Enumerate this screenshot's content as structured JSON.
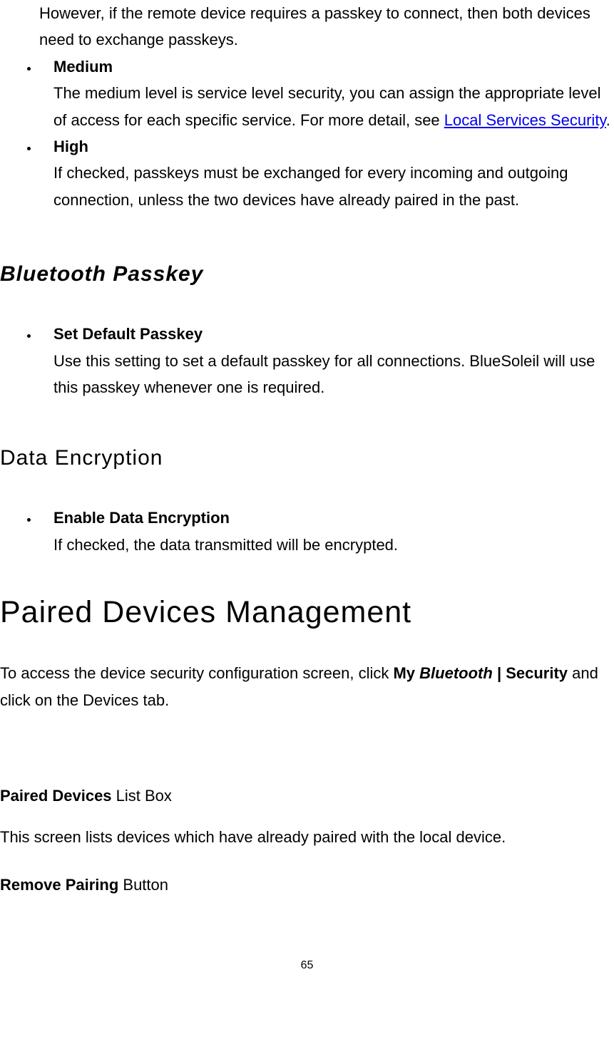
{
  "list1": {
    "item1": {
      "lead_text": "However, if the remote device requires a passkey to connect, then both devices need to exchange passkeys."
    },
    "item2": {
      "title": "Medium",
      "desc_before": "The medium level is service level security, you can assign the appropriate level of access for each specific service. For more detail, see ",
      "link_text": "Local Services Security",
      "desc_after": "."
    },
    "item3": {
      "title": "High",
      "desc": "If checked, passkeys must be exchanged for every incoming and outgoing connection, unless the two devices have already paired in the past."
    }
  },
  "heading1": "Bluetooth Passkey",
  "list2": {
    "item1": {
      "title": "Set Default Passkey",
      "desc": "Use this setting to set a default passkey for all connections. BlueSoleil will use this passkey whenever one is required."
    }
  },
  "heading2": "Data Encryption",
  "list3": {
    "item1": {
      "title": "Enable Data Encryption",
      "desc": "If checked, the data transmitted will be encrypted."
    }
  },
  "heading3": "Paired Devices Management",
  "para1": {
    "before": "To access the device security configuration screen, click ",
    "bold1": "My ",
    "bolditalic": "Bluetooth",
    "bold2": " | Security",
    "after": " and click on the Devices tab."
  },
  "p2_bold": "Paired Devices",
  "p2_rest": " List Box",
  "p3": "This screen lists devices which have already paired with the local device.",
  "p4_bold": "Remove Pairing",
  "p4_rest": " Button",
  "page_num": "65"
}
